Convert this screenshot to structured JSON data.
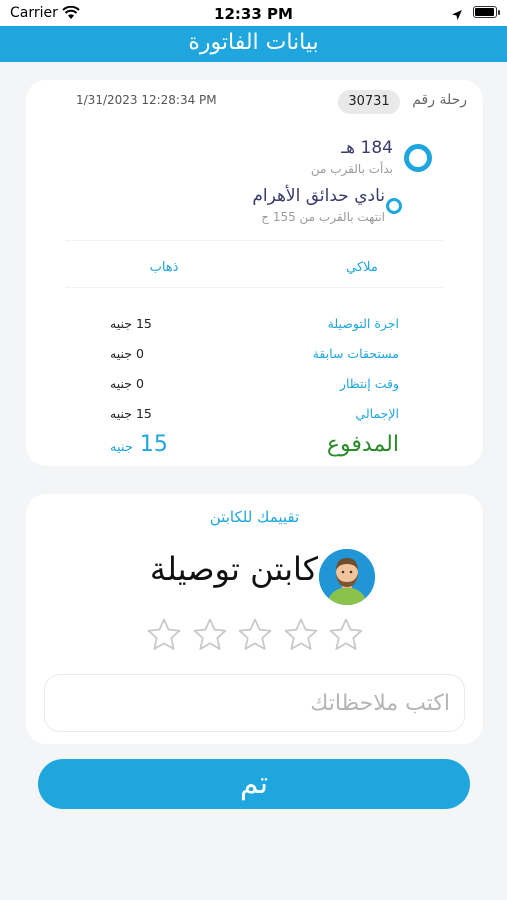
{
  "status_bar": {
    "carrier": "Carrier",
    "time": "12:33 PM"
  },
  "header": {
    "title": "بيانات الفاتورة"
  },
  "trip": {
    "label": "رحلة رقم",
    "number": "30731",
    "date": "1/31/2023 12:28:34 PM",
    "from_name": "184 هـ",
    "from_sub": "بدأت بالقرب من",
    "to_name": "نادي حدائق الأهرام",
    "to_sub": "انتهت بالقرب من 155 ج",
    "type": "ملاكي",
    "direction": "ذهاب"
  },
  "fare": {
    "rows": [
      {
        "label": "اجرة التوصيلة",
        "value": "15 جنيه"
      },
      {
        "label": "مستحقات سابقة",
        "value": "0 جنيه"
      },
      {
        "label": "وقت إنتظار",
        "value": "0 جنيه"
      },
      {
        "label": "الإجمالي",
        "value": "15 جنيه"
      }
    ],
    "paid_label": "المدفوع",
    "paid_amount": "15",
    "paid_unit": "جنيه"
  },
  "rating": {
    "title": "تقييمك للكابتن",
    "captain_name": "كابتن توصيلة",
    "stars_total": 5,
    "stars_selected": 0,
    "notes_placeholder": "اكتب ملاحظاتك",
    "notes_value": ""
  },
  "done_button": {
    "label": "تم"
  },
  "colors": {
    "accent": "#1fa6df",
    "paid": "#2a8a2a",
    "route": "#3b3b6d"
  },
  "icons": [
    "wifi-icon",
    "location-arrow-icon",
    "battery-icon",
    "captain-avatar",
    "star-outline-icon"
  ]
}
